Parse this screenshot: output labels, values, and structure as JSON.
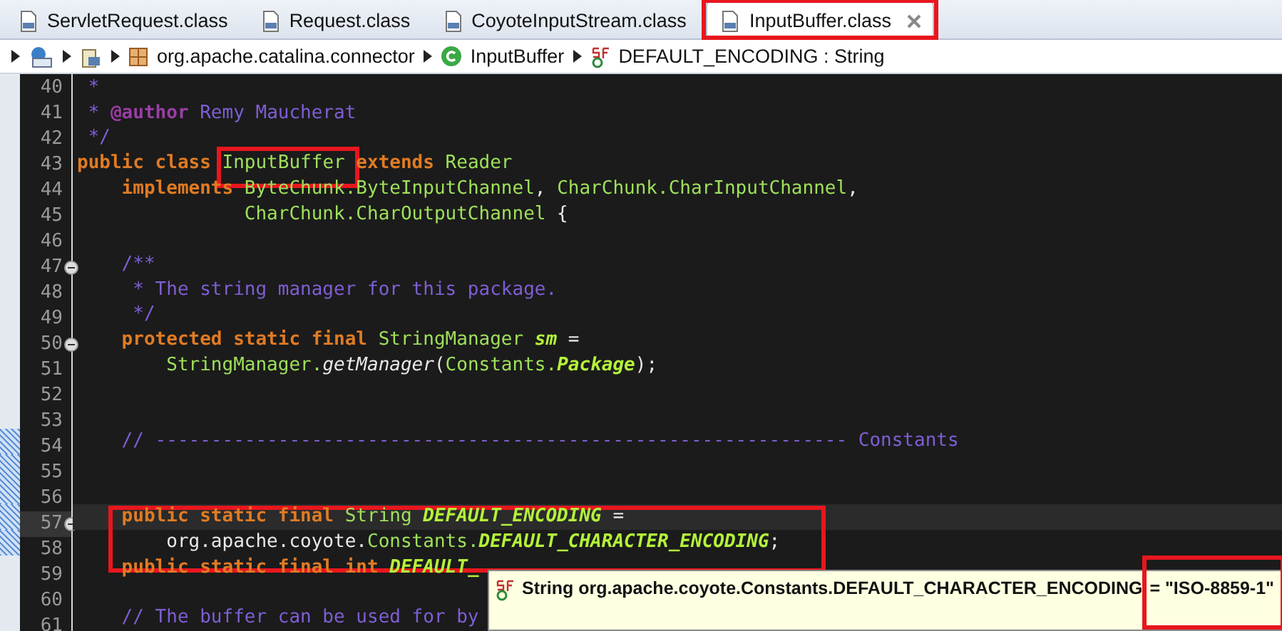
{
  "tabs": [
    {
      "label": "ServletRequest.class",
      "selected": false,
      "marked": false
    },
    {
      "label": "Request.class",
      "selected": false,
      "marked": false
    },
    {
      "label": "CoyoteInputStream.class",
      "selected": false,
      "marked": false
    },
    {
      "label": "InputBuffer.class",
      "selected": true,
      "marked": true
    }
  ],
  "breadcrumb": [
    {
      "kind": "project"
    },
    {
      "kind": "jar"
    },
    {
      "kind": "package",
      "label": "org.apache.catalina.connector"
    },
    {
      "kind": "class",
      "label": "InputBuffer"
    },
    {
      "kind": "field",
      "label": "DEFAULT_ENCODING : String"
    }
  ],
  "lines": [
    {
      "number": "40",
      "fold": false,
      "current": false,
      "changed": false,
      "marked": false,
      "tokens": [
        {
          "text": " *",
          "kind": "comment"
        }
      ]
    },
    {
      "number": "41",
      "fold": false,
      "current": false,
      "changed": false,
      "marked": false,
      "tokens": [
        {
          "text": " * ",
          "kind": "comment"
        },
        {
          "text": "@author",
          "kind": "tag"
        },
        {
          "text": " Remy Maucherat",
          "kind": "comment"
        }
      ]
    },
    {
      "number": "42",
      "fold": false,
      "current": false,
      "changed": false,
      "marked": false,
      "tokens": [
        {
          "text": " */",
          "kind": "comment"
        }
      ]
    },
    {
      "number": "43",
      "fold": false,
      "current": false,
      "changed": false,
      "marked": false,
      "tokens": [
        {
          "text": "public class ",
          "kind": "keyword"
        },
        {
          "text": "InputBuffer",
          "kind": "type",
          "marked": true
        },
        {
          "text": " extends ",
          "kind": "keyword"
        },
        {
          "text": "Reader",
          "kind": "type"
        }
      ]
    },
    {
      "number": "44",
      "fold": false,
      "current": false,
      "changed": false,
      "marked": false,
      "tokens": [
        {
          "text": "    implements ",
          "kind": "keyword"
        },
        {
          "text": "ByteChunk.ByteInputChannel",
          "kind": "type"
        },
        {
          "text": ", ",
          "kind": "plain"
        },
        {
          "text": "CharChunk.CharInputChannel",
          "kind": "type"
        },
        {
          "text": ",",
          "kind": "plain"
        }
      ]
    },
    {
      "number": "45",
      "fold": false,
      "current": false,
      "changed": false,
      "marked": false,
      "tokens": [
        {
          "text": "               CharChunk.CharOutputChannel",
          "kind": "type"
        },
        {
          "text": " {",
          "kind": "plain"
        }
      ]
    },
    {
      "number": "46",
      "fold": false,
      "current": false,
      "changed": false,
      "marked": false
    },
    {
      "number": "47",
      "fold": true,
      "current": false,
      "changed": false,
      "marked": false,
      "tokens": [
        {
          "text": "    /**",
          "kind": "comment"
        }
      ]
    },
    {
      "number": "48",
      "fold": false,
      "current": false,
      "changed": false,
      "marked": false,
      "tokens": [
        {
          "text": "     * The string manager for this package.",
          "kind": "comment"
        }
      ]
    },
    {
      "number": "49",
      "fold": false,
      "current": false,
      "changed": false,
      "marked": false,
      "tokens": [
        {
          "text": "     */",
          "kind": "comment"
        }
      ]
    },
    {
      "number": "50",
      "fold": true,
      "current": false,
      "changed": false,
      "marked": false,
      "tokens": [
        {
          "text": "    protected static final ",
          "kind": "keyword"
        },
        {
          "text": "StringManager ",
          "kind": "type"
        },
        {
          "text": "sm",
          "kind": "field"
        },
        {
          "text": " =",
          "kind": "plain"
        }
      ]
    },
    {
      "number": "51",
      "fold": false,
      "current": false,
      "changed": false,
      "marked": false,
      "tokens": [
        {
          "text": "        StringManager.",
          "kind": "type"
        },
        {
          "text": "getManager",
          "kind": "method"
        },
        {
          "text": "(",
          "kind": "plain"
        },
        {
          "text": "Constants.",
          "kind": "type"
        },
        {
          "text": "Package",
          "kind": "field"
        },
        {
          "text": ");",
          "kind": "plain"
        }
      ]
    },
    {
      "number": "52",
      "fold": false,
      "current": false,
      "changed": false,
      "marked": false
    },
    {
      "number": "53",
      "fold": false,
      "current": false,
      "changed": false,
      "marked": false
    },
    {
      "number": "54",
      "fold": false,
      "current": false,
      "changed": true,
      "marked": false,
      "tokens": [
        {
          "text": "    // -------------------------------------------------------------- Constants",
          "kind": "comment"
        }
      ]
    },
    {
      "number": "55",
      "fold": false,
      "current": false,
      "changed": true,
      "marked": false
    },
    {
      "number": "56",
      "fold": false,
      "current": false,
      "changed": true,
      "marked": false
    },
    {
      "number": "57",
      "fold": true,
      "current": true,
      "changed": true,
      "marked": true,
      "tokens": [
        {
          "text": "    public static final ",
          "kind": "keyword"
        },
        {
          "text": "String ",
          "kind": "type"
        },
        {
          "text": "DEFAULT_ENCODING",
          "kind": "field"
        },
        {
          "text": " =",
          "kind": "plain"
        }
      ]
    },
    {
      "number": "58",
      "fold": false,
      "current": false,
      "changed": true,
      "marked": true,
      "tokens": [
        {
          "text": "        org.apache.coyote.",
          "kind": "plain"
        },
        {
          "text": "Constants.",
          "kind": "type"
        },
        {
          "text": "DEFAULT_CHARACTER_ENCODING",
          "kind": "field"
        },
        {
          "text": ";",
          "kind": "plain"
        }
      ]
    },
    {
      "number": "59",
      "fold": false,
      "current": false,
      "changed": false,
      "marked": false,
      "tokens": [
        {
          "text": "    public static final int ",
          "kind": "keyword"
        },
        {
          "text": "DEFAULT_",
          "kind": "field"
        }
      ]
    },
    {
      "number": "60",
      "fold": false,
      "current": false,
      "changed": false,
      "marked": false
    },
    {
      "number": "61",
      "fold": false,
      "current": false,
      "changed": false,
      "marked": false,
      "tokens": [
        {
          "text": "    // The buffer can be used for by",
          "kind": "comment"
        }
      ]
    }
  ],
  "tooltip": {
    "text": "String org.apache.coyote.Constants.DEFAULT_CHARACTER_ENCODING",
    "value": "= \"ISO-8859-1\"",
    "value_marked": true
  }
}
